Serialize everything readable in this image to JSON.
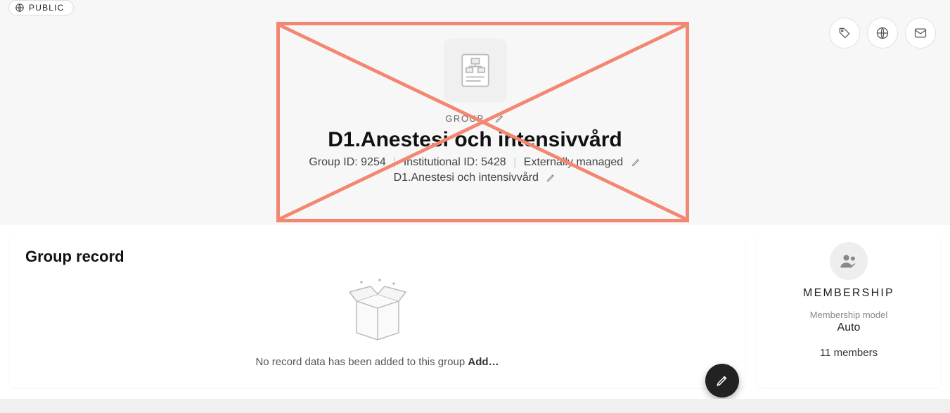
{
  "badge": {
    "label": "PUBLIC"
  },
  "header": {
    "typeLabel": "GROUP",
    "name": "D1.Anestesi och intensivvård",
    "groupIdLabel": "Group ID:",
    "groupId": "9254",
    "institutionalIdLabel": "Institutional ID:",
    "institutionalId": "5428",
    "managed": "Externally managed",
    "path": "D1.Anestesi och intensivvård"
  },
  "actions": {
    "tag": "tag-icon",
    "globe": "globe-icon",
    "mail": "mail-icon"
  },
  "record": {
    "title": "Group record",
    "emptyText": "No record data has been added to this group",
    "addLink": "Add…"
  },
  "membership": {
    "title": "MEMBERSHIP",
    "modelLabel": "Membership model",
    "modelValue": "Auto",
    "count": "11 members"
  }
}
